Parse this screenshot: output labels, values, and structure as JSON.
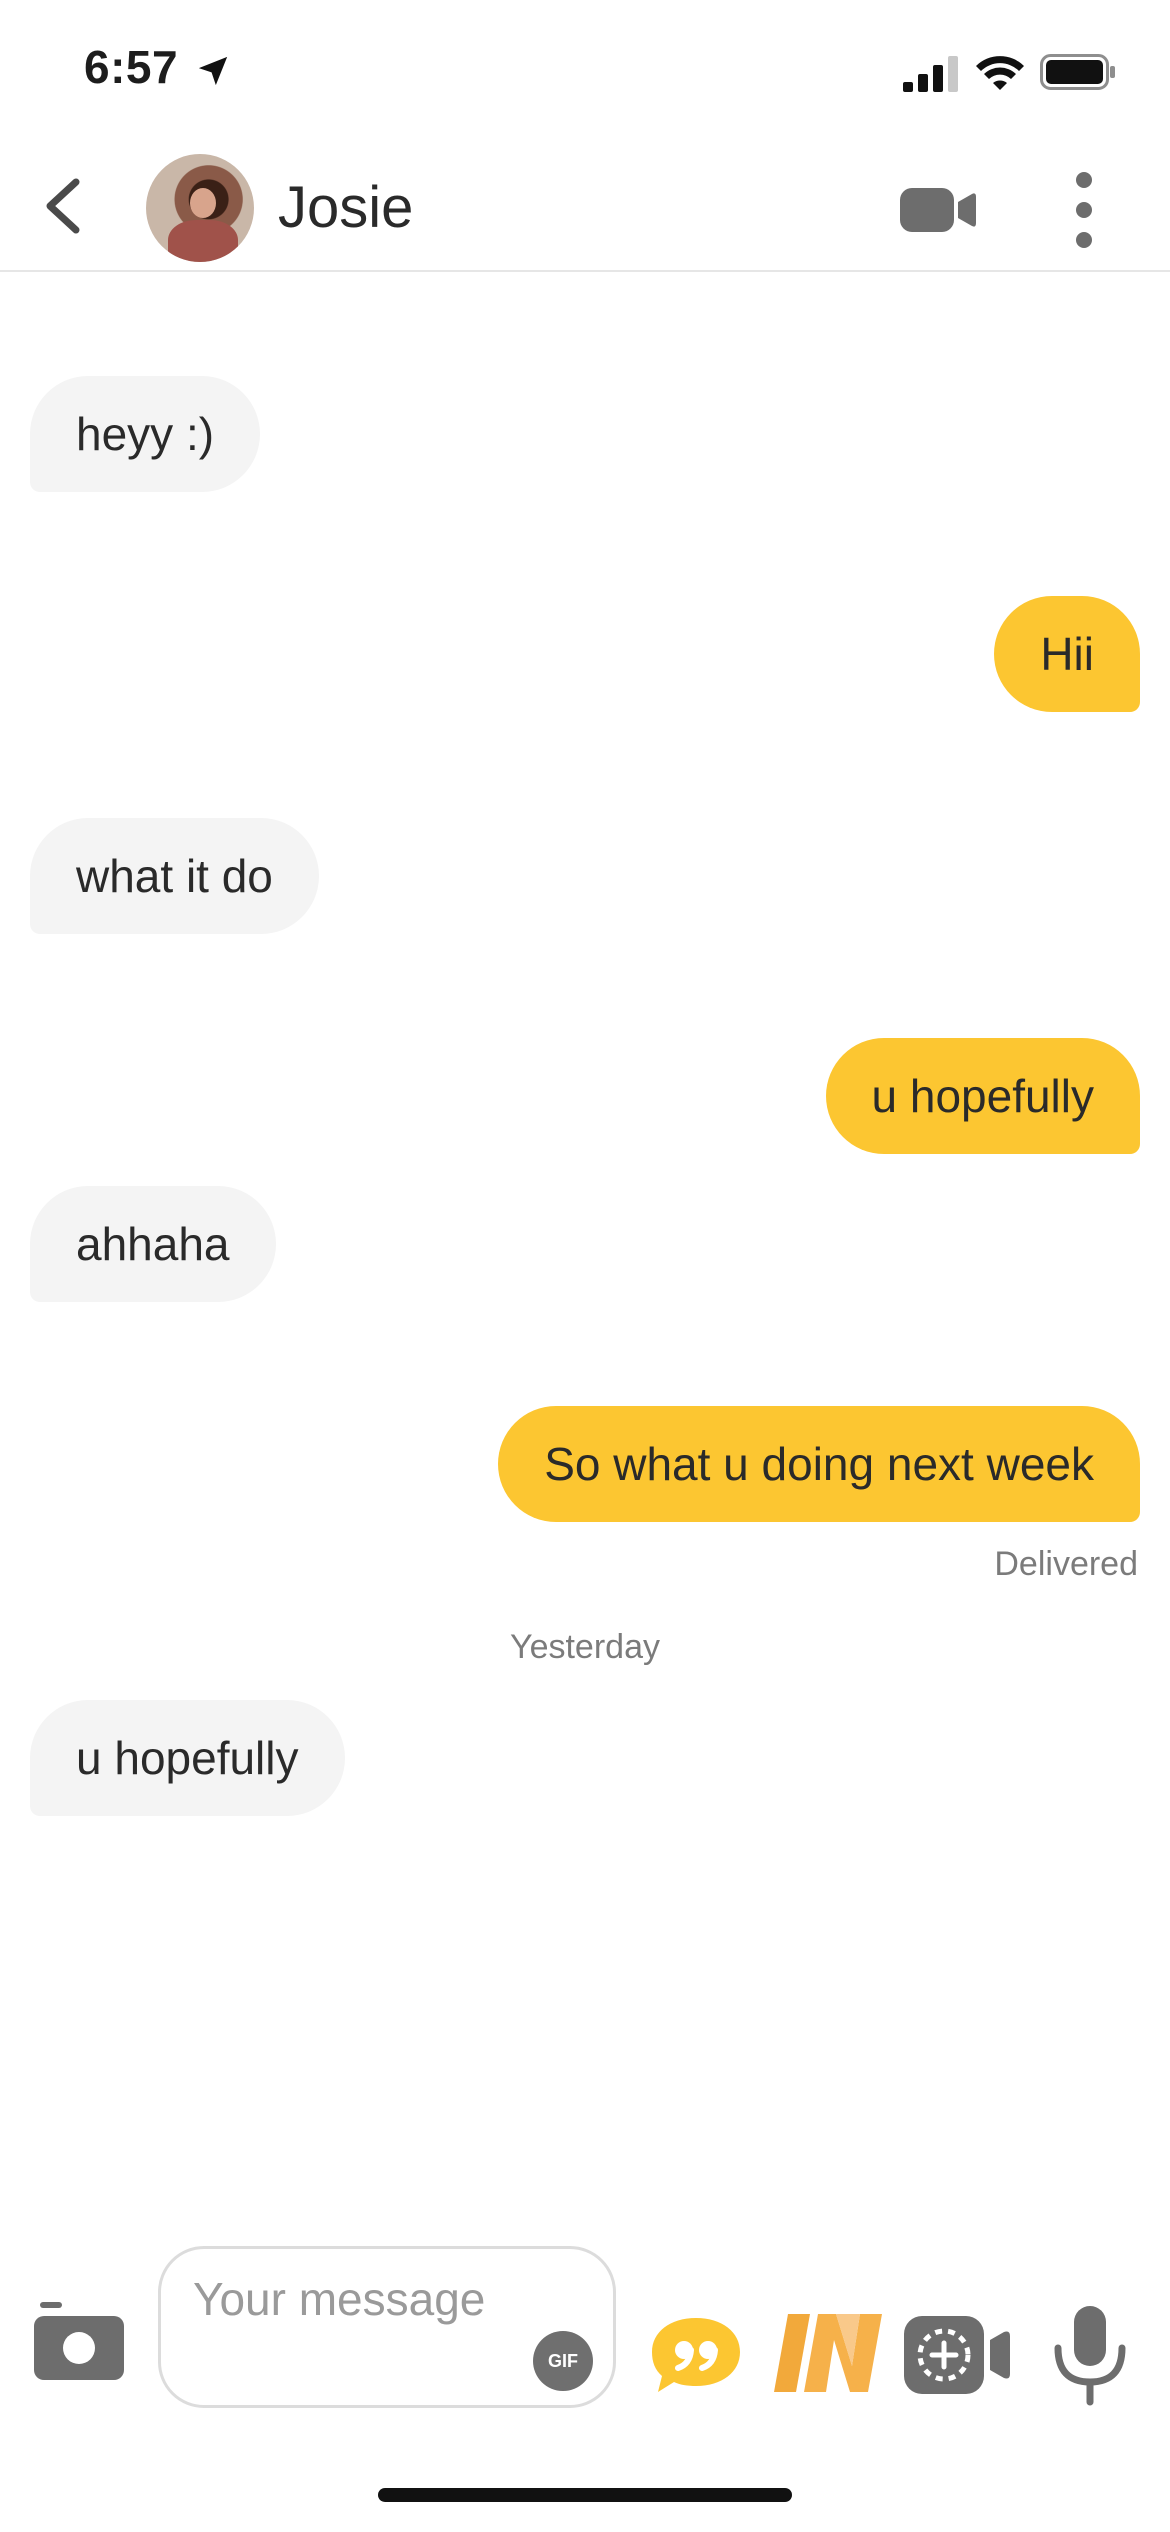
{
  "status_bar": {
    "time": "6:57"
  },
  "header": {
    "contact_name": "Josie"
  },
  "messages": [
    {
      "text": "heyy :)",
      "direction": "incoming"
    },
    {
      "text": "Hii",
      "direction": "outgoing"
    },
    {
      "text": "what it do",
      "direction": "incoming"
    },
    {
      "text": "u hopefully",
      "direction": "outgoing"
    },
    {
      "text": "ahhaha",
      "direction": "incoming"
    },
    {
      "text": "So what u doing next week",
      "direction": "outgoing"
    },
    {
      "text": "u hopefully",
      "direction": "incoming"
    }
  ],
  "delivery_status": "Delivered",
  "day_separator": "Yesterday",
  "composer": {
    "placeholder": "Your message",
    "gif_label": "GIF",
    "icons": [
      "camera-icon",
      "gif-icon",
      "quote-icon",
      "in-icon",
      "video-note-icon",
      "microphone-icon"
    ]
  },
  "colors": {
    "accent": "#fcc631",
    "incoming_bubble": "#f4f4f4",
    "text": "#2a2a2a"
  }
}
